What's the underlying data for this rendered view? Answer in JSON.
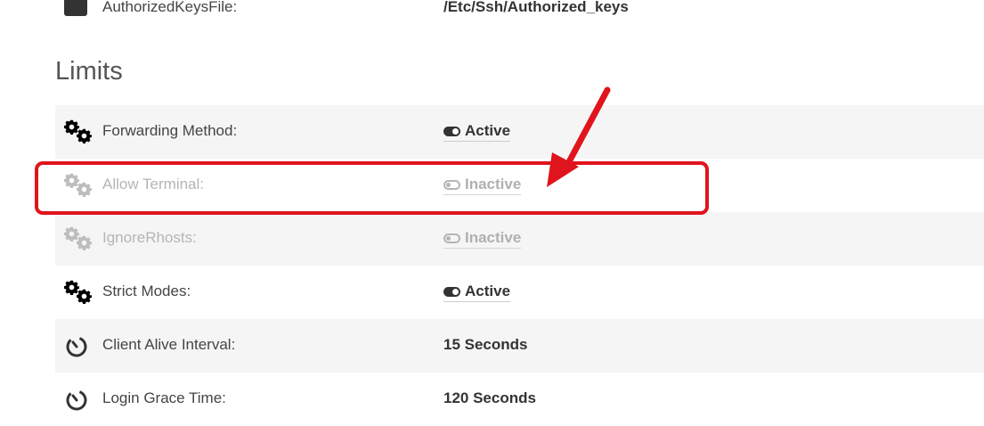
{
  "top_setting": {
    "label": "AuthorizedKeysFile:",
    "value": "/Etc/Ssh/Authorized_keys"
  },
  "section": {
    "title": "Limits"
  },
  "rows": [
    {
      "label": "Forwarding Method:",
      "value": "Active",
      "icon": "gears-icon",
      "state": "on"
    },
    {
      "label": "Allow Terminal:",
      "value": "Inactive",
      "icon": "gears-icon",
      "state": "off"
    },
    {
      "label": "IgnoreRhosts:",
      "value": "Inactive",
      "icon": "gears-icon",
      "state": "off"
    },
    {
      "label": "Strict Modes:",
      "value": "Active",
      "icon": "gears-icon",
      "state": "on"
    },
    {
      "label": "Client Alive Interval:",
      "value": "15 Seconds",
      "icon": "timer-icon"
    },
    {
      "label": "Login Grace Time:",
      "value": "120 Seconds",
      "icon": "timer-icon"
    }
  ],
  "colors": {
    "annotation": "#e0141d",
    "active": "#333333",
    "inactive": "#b5b5b5",
    "row_stripe": "#f5f5f5"
  }
}
